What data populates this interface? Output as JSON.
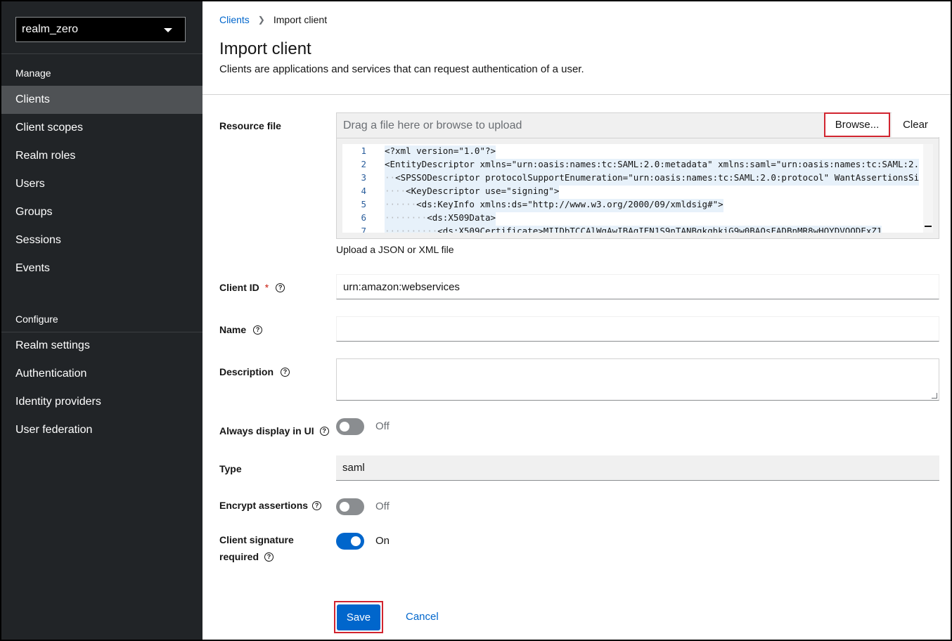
{
  "sidebar": {
    "realm": "realm_zero",
    "manage_heading": "Manage",
    "configure_heading": "Configure",
    "manage_items": [
      "Clients",
      "Client scopes",
      "Realm roles",
      "Users",
      "Groups",
      "Sessions",
      "Events"
    ],
    "configure_items": [
      "Realm settings",
      "Authentication",
      "Identity providers",
      "User federation"
    ],
    "active_item": "Clients"
  },
  "breadcrumb": {
    "parent": "Clients",
    "current": "Import client"
  },
  "header": {
    "title": "Import client",
    "description": "Clients are applications and services that can request authentication of a user."
  },
  "form": {
    "resource_file": {
      "label": "Resource file",
      "placeholder": "Drag a file here or browse to upload",
      "browse_label": "Browse...",
      "clear_label": "Clear",
      "help": "Upload a JSON or XML file",
      "code_lines": [
        {
          "n": "1",
          "indent": "",
          "text": "<?xml version=\"1.0\"?>"
        },
        {
          "n": "2",
          "indent": "",
          "text": "<EntityDescriptor xmlns=\"urn:oasis:names:tc:SAML:2.0:metadata\" xmlns:saml=\"urn:oasis:names:tc:SAML:2."
        },
        {
          "n": "3",
          "indent": "··",
          "text": "<SPSSODescriptor protocolSupportEnumeration=\"urn:oasis:names:tc:SAML:2.0:protocol\" WantAssertionsSi"
        },
        {
          "n": "4",
          "indent": "····",
          "text": "<KeyDescriptor use=\"signing\">"
        },
        {
          "n": "5",
          "indent": "······",
          "text": "<ds:KeyInfo xmlns:ds=\"http://www.w3.org/2000/09/xmldsig#\">"
        },
        {
          "n": "6",
          "indent": "········",
          "text": "<ds:X509Data>"
        },
        {
          "n": "7",
          "indent": "··········",
          "text": "<ds:X509Certificate>MIIDbTCCAlWgAwIBAgIEN1S9nTANBgkqhkiG9w0BAQsFADBnMR8wHQYDVQQDExZ1"
        }
      ]
    },
    "client_id": {
      "label": "Client ID",
      "required_mark": "*",
      "value": "urn:amazon:webservices"
    },
    "name": {
      "label": "Name",
      "value": ""
    },
    "description": {
      "label": "Description",
      "value": ""
    },
    "always_display": {
      "label": "Always display in UI",
      "state": "Off"
    },
    "type": {
      "label": "Type",
      "value": "saml"
    },
    "encrypt_assertions": {
      "label": "Encrypt assertions",
      "state": "Off"
    },
    "client_signature": {
      "label_line1": "Client signature",
      "label_line2": "required",
      "state": "On"
    }
  },
  "actions": {
    "save": "Save",
    "cancel": "Cancel"
  },
  "colors": {
    "sidebar_bg": "#212427",
    "accent": "#0066cc",
    "highlight_outline": "#d1242f"
  },
  "icons": {
    "help": "help-circle-icon",
    "dropdown": "caret-down-icon"
  }
}
